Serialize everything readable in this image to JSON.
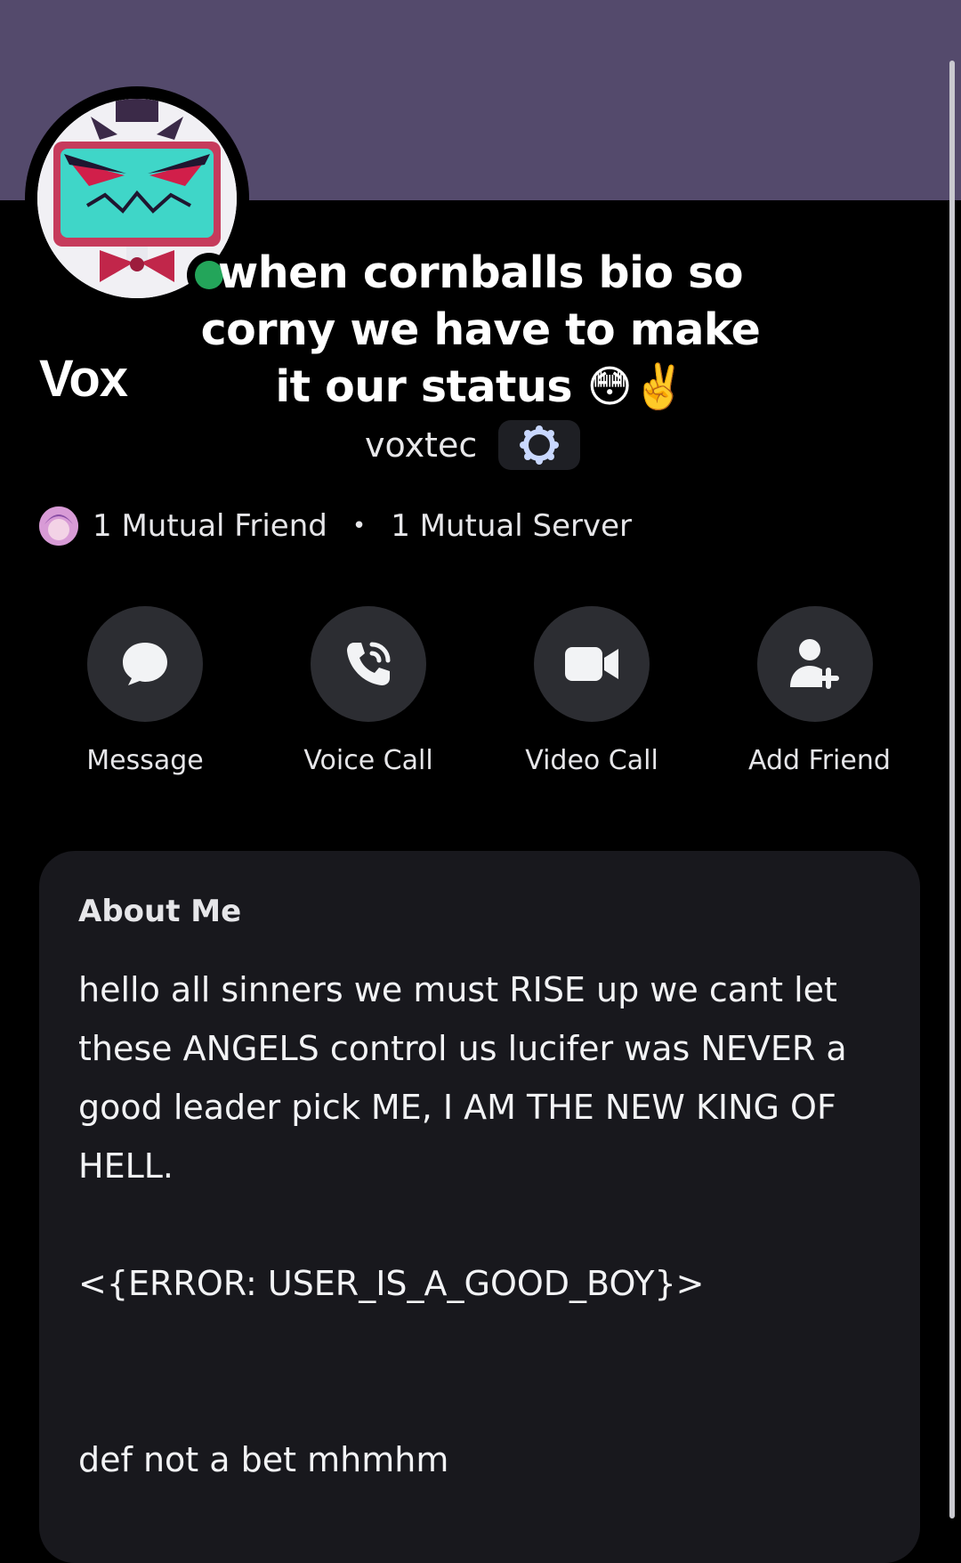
{
  "overlay": {
    "caption": "when cornballs bio so corny we have to make it our status 😳✌️"
  },
  "profile": {
    "display_name": "Vox",
    "username": "voxtec",
    "status": "online",
    "badge_icon": "nitro-badge-icon"
  },
  "mutuals": {
    "friends": "1 Mutual Friend",
    "separator": "•",
    "servers": "1 Mutual Server"
  },
  "actions": [
    {
      "label": "Message",
      "icon": "chat-bubble-icon"
    },
    {
      "label": "Voice Call",
      "icon": "phone-icon"
    },
    {
      "label": "Video Call",
      "icon": "video-camera-icon"
    },
    {
      "label": "Add Friend",
      "icon": "add-friend-icon"
    }
  ],
  "about": {
    "title": "About Me",
    "bio": "hello all sinners we must RISE up we cant let these ANGELS control us lucifer was NEVER a good leader pick ME, I AM THE NEW KING OF HELL.\n\n<{ERROR: USER_IS_A_GOOD_BOY}>\n\n\ndef not a bet mhmhm"
  },
  "colors": {
    "banner": "#544a6c",
    "background": "#000000",
    "card": "#18181d",
    "button": "#2c2d32",
    "online": "#23a55a"
  }
}
